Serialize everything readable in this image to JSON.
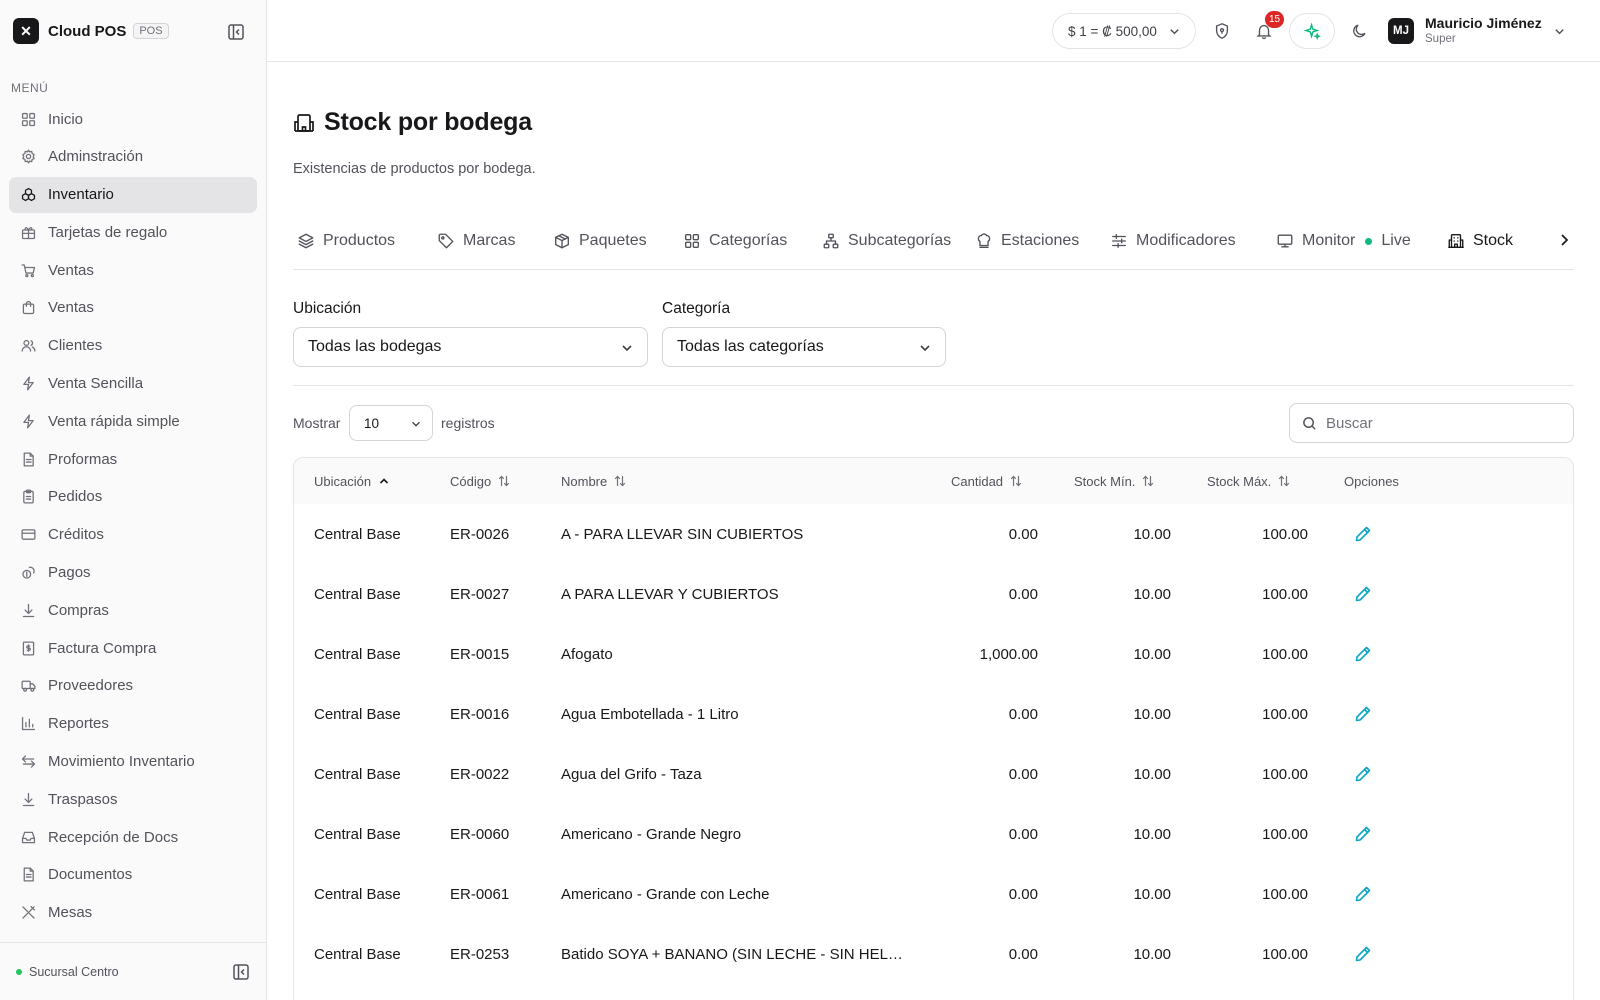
{
  "brand": {
    "logo": "✕",
    "name": "Cloud POS",
    "badge": "POS"
  },
  "sidebar": {
    "heading": "MENÚ",
    "items": [
      {
        "label": "Inicio",
        "icon": "grid-icon",
        "active": false
      },
      {
        "label": "Adminstración",
        "icon": "gear-icon",
        "active": false
      },
      {
        "label": "Inventario",
        "icon": "boxes-icon",
        "active": true
      },
      {
        "label": "Tarjetas de regalo",
        "icon": "gift-icon",
        "active": false
      },
      {
        "label": "Ventas",
        "icon": "cart-icon",
        "active": false
      },
      {
        "label": "Ventas",
        "icon": "bag-icon",
        "active": false
      },
      {
        "label": "Clientes",
        "icon": "users-icon",
        "active": false
      },
      {
        "label": "Venta Sencilla",
        "icon": "bolt-icon",
        "active": false
      },
      {
        "label": "Venta rápida simple",
        "icon": "bolt-icon",
        "active": false
      },
      {
        "label": "Proformas",
        "icon": "document-icon",
        "active": false
      },
      {
        "label": "Pedidos",
        "icon": "clipboard-icon",
        "active": false
      },
      {
        "label": "Créditos",
        "icon": "credit-card-icon",
        "active": false
      },
      {
        "label": "Pagos",
        "icon": "coins-icon",
        "active": false
      },
      {
        "label": "Compras",
        "icon": "download-icon",
        "active": false
      },
      {
        "label": "Factura Compra",
        "icon": "invoice-icon",
        "active": false
      },
      {
        "label": "Proveedores",
        "icon": "truck-icon",
        "active": false
      },
      {
        "label": "Reportes",
        "icon": "bar-chart-icon",
        "active": false
      },
      {
        "label": "Movimiento Inventario",
        "icon": "arrows-icon",
        "active": false
      },
      {
        "label": "Traspasos",
        "icon": "download-icon",
        "active": false
      },
      {
        "label": "Recepción de Docs",
        "icon": "inbox-icon",
        "active": false
      },
      {
        "label": "Documentos",
        "icon": "document-icon",
        "active": false
      },
      {
        "label": "Mesas",
        "icon": "utensils-icon",
        "active": false
      }
    ],
    "footer": {
      "branch": "Sucursal Centro"
    }
  },
  "topbar": {
    "exchange_rate": "$ 1 =  ₡ 500,00",
    "notifications_count": "15",
    "user": {
      "initials": "MJ",
      "name": "Mauricio Jiménez",
      "role": "Super"
    }
  },
  "page": {
    "title": "Stock por bodega",
    "subtitle": "Existencias de productos por bodega."
  },
  "tabs": [
    {
      "label": "Productos",
      "icon": "layers-icon",
      "active": false
    },
    {
      "label": "Marcas",
      "icon": "tag-icon",
      "active": false
    },
    {
      "label": "Paquetes",
      "icon": "package-icon",
      "active": false
    },
    {
      "label": "Categorías",
      "icon": "grid-icon",
      "active": false
    },
    {
      "label": "Subcategorías",
      "icon": "hierarchy-icon",
      "active": false
    },
    {
      "label": "Estaciones",
      "icon": "chef-hat-icon",
      "active": false
    },
    {
      "label": "Modificadores",
      "icon": "sliders-icon",
      "active": false
    },
    {
      "label": "Monitor",
      "icon": "monitor-icon",
      "active": false,
      "live": "Live"
    },
    {
      "label": "Stock",
      "icon": "building-icon",
      "active": true
    }
  ],
  "filters": {
    "location": {
      "label": "Ubicación",
      "value": "Todas las bodegas"
    },
    "category": {
      "label": "Categoría",
      "value": "Todas las categorías"
    }
  },
  "table_controls": {
    "show_label": "Mostrar",
    "page_size": "10",
    "records_label": "registros",
    "search_placeholder": "Buscar"
  },
  "table": {
    "columns": [
      "Ubicación",
      "Código",
      "Nombre",
      "Cantidad",
      "Stock Mín.",
      "Stock Máx.",
      "Opciones"
    ],
    "rows": [
      {
        "location": "Central Base",
        "code": "ER-0026",
        "name": "A - PARA LLEVAR SIN CUBIERTOS",
        "qty": "0.00",
        "min": "10.00",
        "max": "100.00"
      },
      {
        "location": "Central Base",
        "code": "ER-0027",
        "name": "A PARA LLEVAR Y CUBIERTOS",
        "qty": "0.00",
        "min": "10.00",
        "max": "100.00"
      },
      {
        "location": "Central Base",
        "code": "ER-0015",
        "name": "Afogato",
        "qty": "1,000.00",
        "min": "10.00",
        "max": "100.00"
      },
      {
        "location": "Central Base",
        "code": "ER-0016",
        "name": "Agua Embotellada - 1 Litro",
        "qty": "0.00",
        "min": "10.00",
        "max": "100.00"
      },
      {
        "location": "Central Base",
        "code": "ER-0022",
        "name": "Agua del Grifo - Taza",
        "qty": "0.00",
        "min": "10.00",
        "max": "100.00"
      },
      {
        "location": "Central Base",
        "code": "ER-0060",
        "name": "Americano - Grande Negro",
        "qty": "0.00",
        "min": "10.00",
        "max": "100.00"
      },
      {
        "location": "Central Base",
        "code": "ER-0061",
        "name": "Americano - Grande con Leche",
        "qty": "0.00",
        "min": "10.00",
        "max": "100.00"
      },
      {
        "location": "Central Base",
        "code": "ER-0253",
        "name": "Batido SOYA + BANANO (SIN LECHE - SIN HELADO)",
        "qty": "0.00",
        "min": "10.00",
        "max": "100.00"
      }
    ]
  },
  "colors": {
    "accent": "#18181b",
    "edit": "#0ea5c6",
    "live": "#10b981",
    "badge": "#dc2626"
  }
}
